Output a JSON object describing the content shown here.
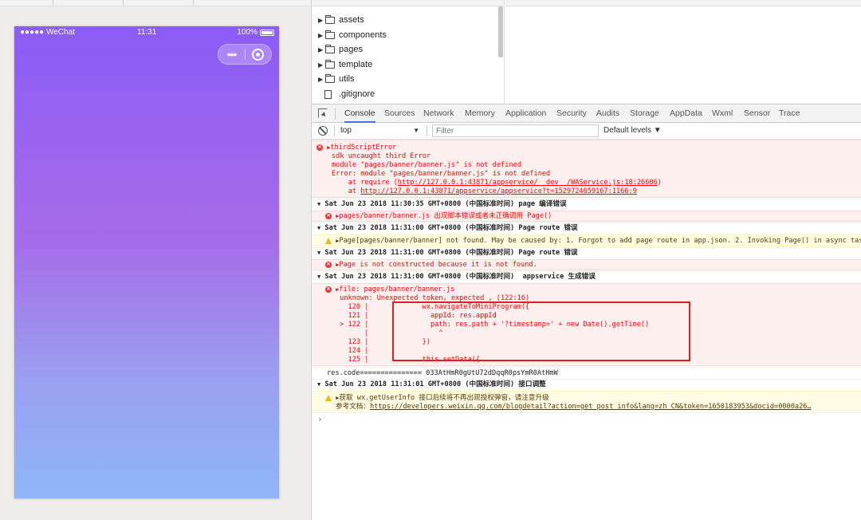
{
  "simulator": {
    "carrier": "●●●●● WeChat",
    "time": "11:31",
    "battery": "100%",
    "capsule_more": "•••",
    "colors": {
      "gradient_top": "#8b5cf6",
      "gradient_bottom": "#8fb6f8"
    }
  },
  "file_tree": {
    "items": [
      {
        "label": "assets",
        "type": "folder"
      },
      {
        "label": "components",
        "type": "folder"
      },
      {
        "label": "pages",
        "type": "folder"
      },
      {
        "label": "template",
        "type": "folder"
      },
      {
        "label": "utils",
        "type": "folder"
      },
      {
        "label": ".gitignore",
        "type": "file"
      }
    ]
  },
  "devtools": {
    "tabs": [
      "Console",
      "Sources",
      "Network",
      "Memory",
      "Application",
      "Security",
      "Audits",
      "Storage",
      "AppData",
      "Wxml",
      "Sensor",
      "Trace"
    ],
    "active_tab": "Console",
    "context": "top",
    "filter_placeholder": "Filter",
    "levels": "Default levels ▼"
  },
  "console": {
    "e1": {
      "l1": "thirdScriptError",
      "l2": "sdk uncaught third Error",
      "l3": "module \"pages/banner/banner.js\" is not defined",
      "l4": "Error: module \"pages/banner/banner.js\" is not defined",
      "l5a": "    at require (",
      "l5link": "http://127.0.0.1:43871/appservice/__dev__/WAService.js:18:26606",
      "l5b": ")",
      "l6a": "    at ",
      "l6link": "http://127.0.0.1:43871/appservice/appservice?t=1529724659167:1166:9"
    },
    "g1": "Sat Jun 23 2018 11:30:35 GMT+0800 (中国标准时间) page 编译错误",
    "g1e": "pages/banner/banner.js 出现脚本错误或者未正确调用 Page()",
    "g2": "Sat Jun 23 2018 11:31:00 GMT+0800 (中国标准时间) Page route 错误",
    "g2w": "Page[pages/banner/banner] not found. May be caused by: 1. Forgot to add page route in app.json. 2. Invoking Page() in async task.",
    "g3": "Sat Jun 23 2018 11:31:00 GMT+0800 (中国标准时间) Page route 错误",
    "g3e": "Page is not constructed because it is not found.",
    "g4": "Sat Jun 23 2018 11:31:00 GMT+0800 (中国标准时间)  appservice 生成错误",
    "g4e": {
      "l1": "file: pages/banner/banner.js",
      "l2": " unknown: Unexpected token, expected , (122:16)",
      "l3": "   120 |             wx.navigateToMiniProgram({",
      "l4": "   121 |               appId: res.appId",
      "l5": " > 122 |               path: res.path + '?timestamp=' + new Date().getTime()",
      "l6": "       |                 ^",
      "l7": "   123 |             })",
      "l8": "   124 |",
      "l9": "   125 |             this.setData({"
    },
    "plain": "res.code=============== 033AtHmR0gUtU72dDqqR0psYmR0AtHmW",
    "g5": "Sat Jun 23 2018 11:31:01 GMT+0800 (中国标准时间) 接口调整",
    "g5w1": "获取 wx.getUserInfo 接口后续将不再出现授权弹窗，请注意升级",
    "g5w2a": "参考文档：",
    "g5w2link": "https://developers.weixin.qq.com/blogdetail?action=get_post_info&lang=zh_CN&token=1650183953&docid=0000a26…",
    "prompt": "›"
  }
}
